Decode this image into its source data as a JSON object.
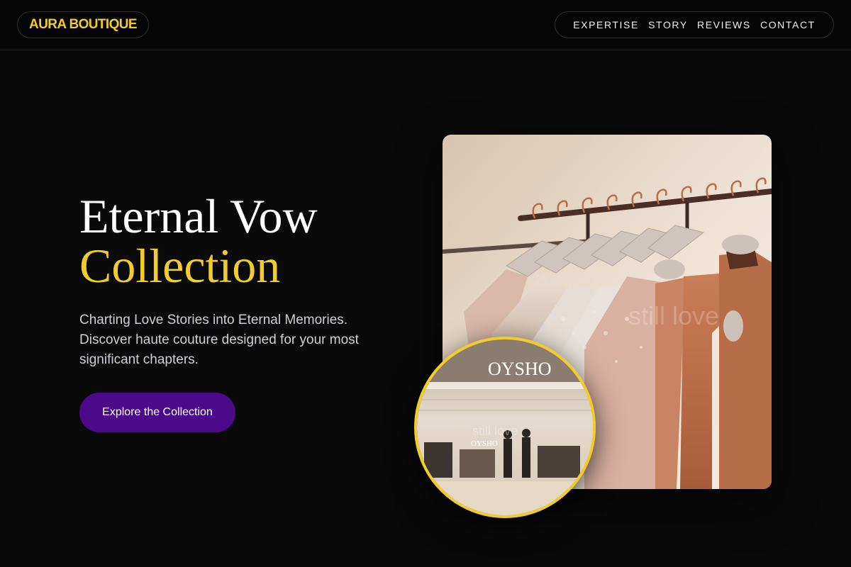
{
  "brand": {
    "name": "AURA BOUTIQUE",
    "accent_color": "#f2cc2a"
  },
  "nav": {
    "items": [
      {
        "label": "EXPERTISE"
      },
      {
        "label": "STORY"
      },
      {
        "label": "REVIEWS"
      },
      {
        "label": "CONTACT"
      }
    ]
  },
  "hero": {
    "title_line1": "Eternal Vow",
    "title_line2": "Collection",
    "subtitle": "Charting Love Stories into Eternal Memories. Discover haute couture designed for your most significant chapters.",
    "cta_label": "Explore the Collection",
    "cta_color": "#4b0a8a"
  },
  "images": {
    "main_photo": {
      "watermark": "still love"
    },
    "store_photo": {
      "sign": "OYSHO",
      "inner_sign": "OYSHO",
      "watermark": "still love"
    }
  }
}
